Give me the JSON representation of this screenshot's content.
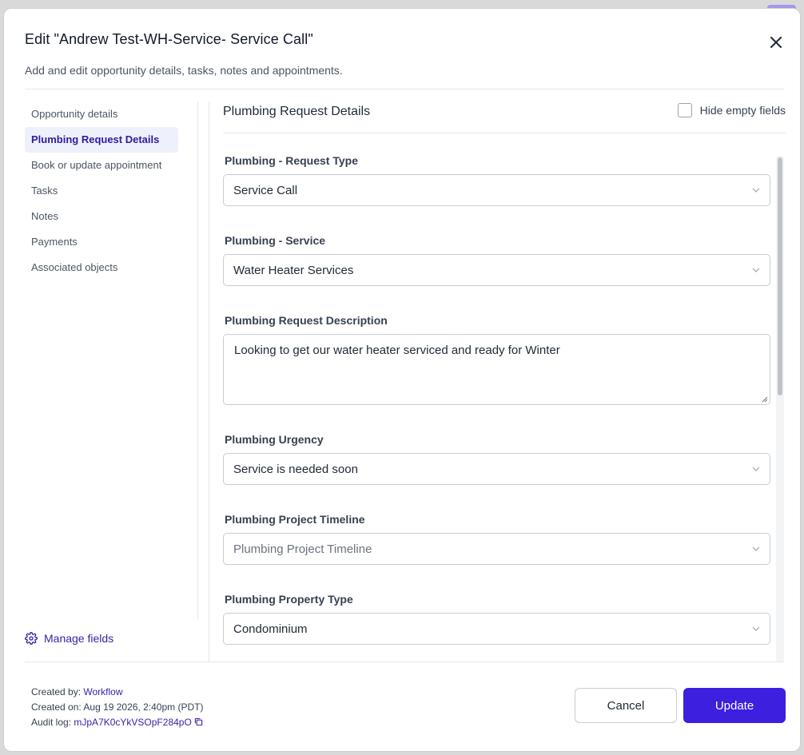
{
  "modal": {
    "title": "Edit \"Andrew Test-WH-Service- Service Call\"",
    "subtitle": "Add and edit opportunity details, tasks, notes and appointments."
  },
  "sidebar": {
    "items": [
      {
        "label": "Opportunity details",
        "active": false
      },
      {
        "label": "Plumbing Request Details",
        "active": true
      },
      {
        "label": "Book or update appointment",
        "active": false
      },
      {
        "label": "Tasks",
        "active": false
      },
      {
        "label": "Notes",
        "active": false
      },
      {
        "label": "Payments",
        "active": false
      },
      {
        "label": "Associated objects",
        "active": false
      }
    ],
    "manage_fields": "Manage fields"
  },
  "section": {
    "title": "Plumbing Request Details",
    "hide_empty_label": "Hide empty fields",
    "hide_empty_checked": false
  },
  "fields": {
    "request_type": {
      "label": "Plumbing - Request Type",
      "value": "Service Call"
    },
    "service": {
      "label": "Plumbing - Service",
      "value": "Water Heater Services"
    },
    "description": {
      "label": "Plumbing Request Description",
      "value": "Looking to get our water heater serviced and ready for Winter"
    },
    "urgency": {
      "label": "Plumbing Urgency",
      "value": "Service is needed soon"
    },
    "timeline": {
      "label": "Plumbing Project Timeline",
      "placeholder": "Plumbing Project Timeline"
    },
    "property_type": {
      "label": "Plumbing Property Type",
      "value": "Condominium"
    }
  },
  "footer": {
    "created_by_label": "Created by:",
    "created_by_value": "Workflow",
    "created_on_label": "Created on:",
    "created_on_value": "Aug 19 2026, 2:40pm (PDT)",
    "audit_label": "Audit log:",
    "audit_value": "mJpA7K0cYkVSOpF284pO",
    "cancel_label": "Cancel",
    "update_label": "Update"
  },
  "colors": {
    "accent": "#3d1fe0",
    "link": "#3b21a8",
    "active_bg": "#eef0fb"
  }
}
